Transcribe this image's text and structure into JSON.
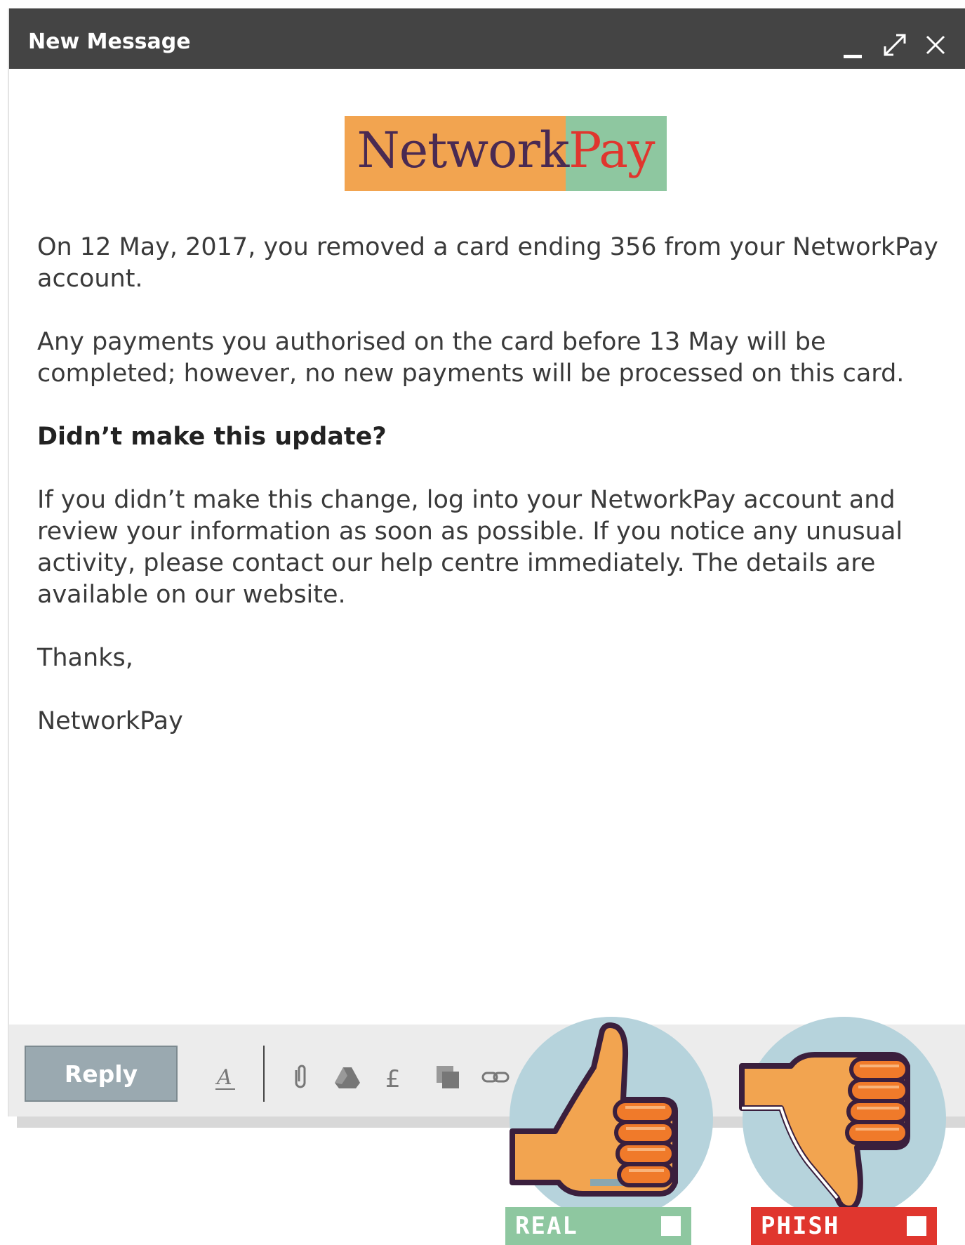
{
  "window": {
    "title": "New Message",
    "controls": [
      "minimize-icon",
      "expand-icon",
      "close-icon"
    ]
  },
  "logo": {
    "text_part1": "Network",
    "text_part2": "Pay",
    "colors": {
      "left_bg": "#f2a450",
      "right_bg": "#8ec7a0",
      "part1": "#4a2a52",
      "part2": "#e0362e"
    }
  },
  "email": {
    "para1": "On 12 May, 2017, you removed a card ending 356 from your NetworkPay account.",
    "para2": "Any payments you authorised on the card before 13 May will be completed; however, no new payments will be processed on this card.",
    "heading": "Didn’t make this update?",
    "para3": "If you didn’t make this change, log into your NetworkPay account and review your information as soon as possible. If you notice any unusual activity, please contact our help centre immediately. The details are available on our website.",
    "signoff": "Thanks,",
    "signature": "NetworkPay"
  },
  "toolbar": {
    "reply_label": "Reply",
    "icons": [
      "format-text-icon",
      "attach-icon",
      "drive-icon",
      "pound-icon",
      "copy-icon",
      "link-icon",
      "emoji-icon"
    ]
  },
  "votes": {
    "real_label": "REAL",
    "phish_label": "PHISH",
    "colors": {
      "real": "#8ec7a0",
      "phish": "#e0362e",
      "circle": "#b6d3dc",
      "hand": "#f2a450",
      "outline": "#3a1f3d"
    }
  }
}
